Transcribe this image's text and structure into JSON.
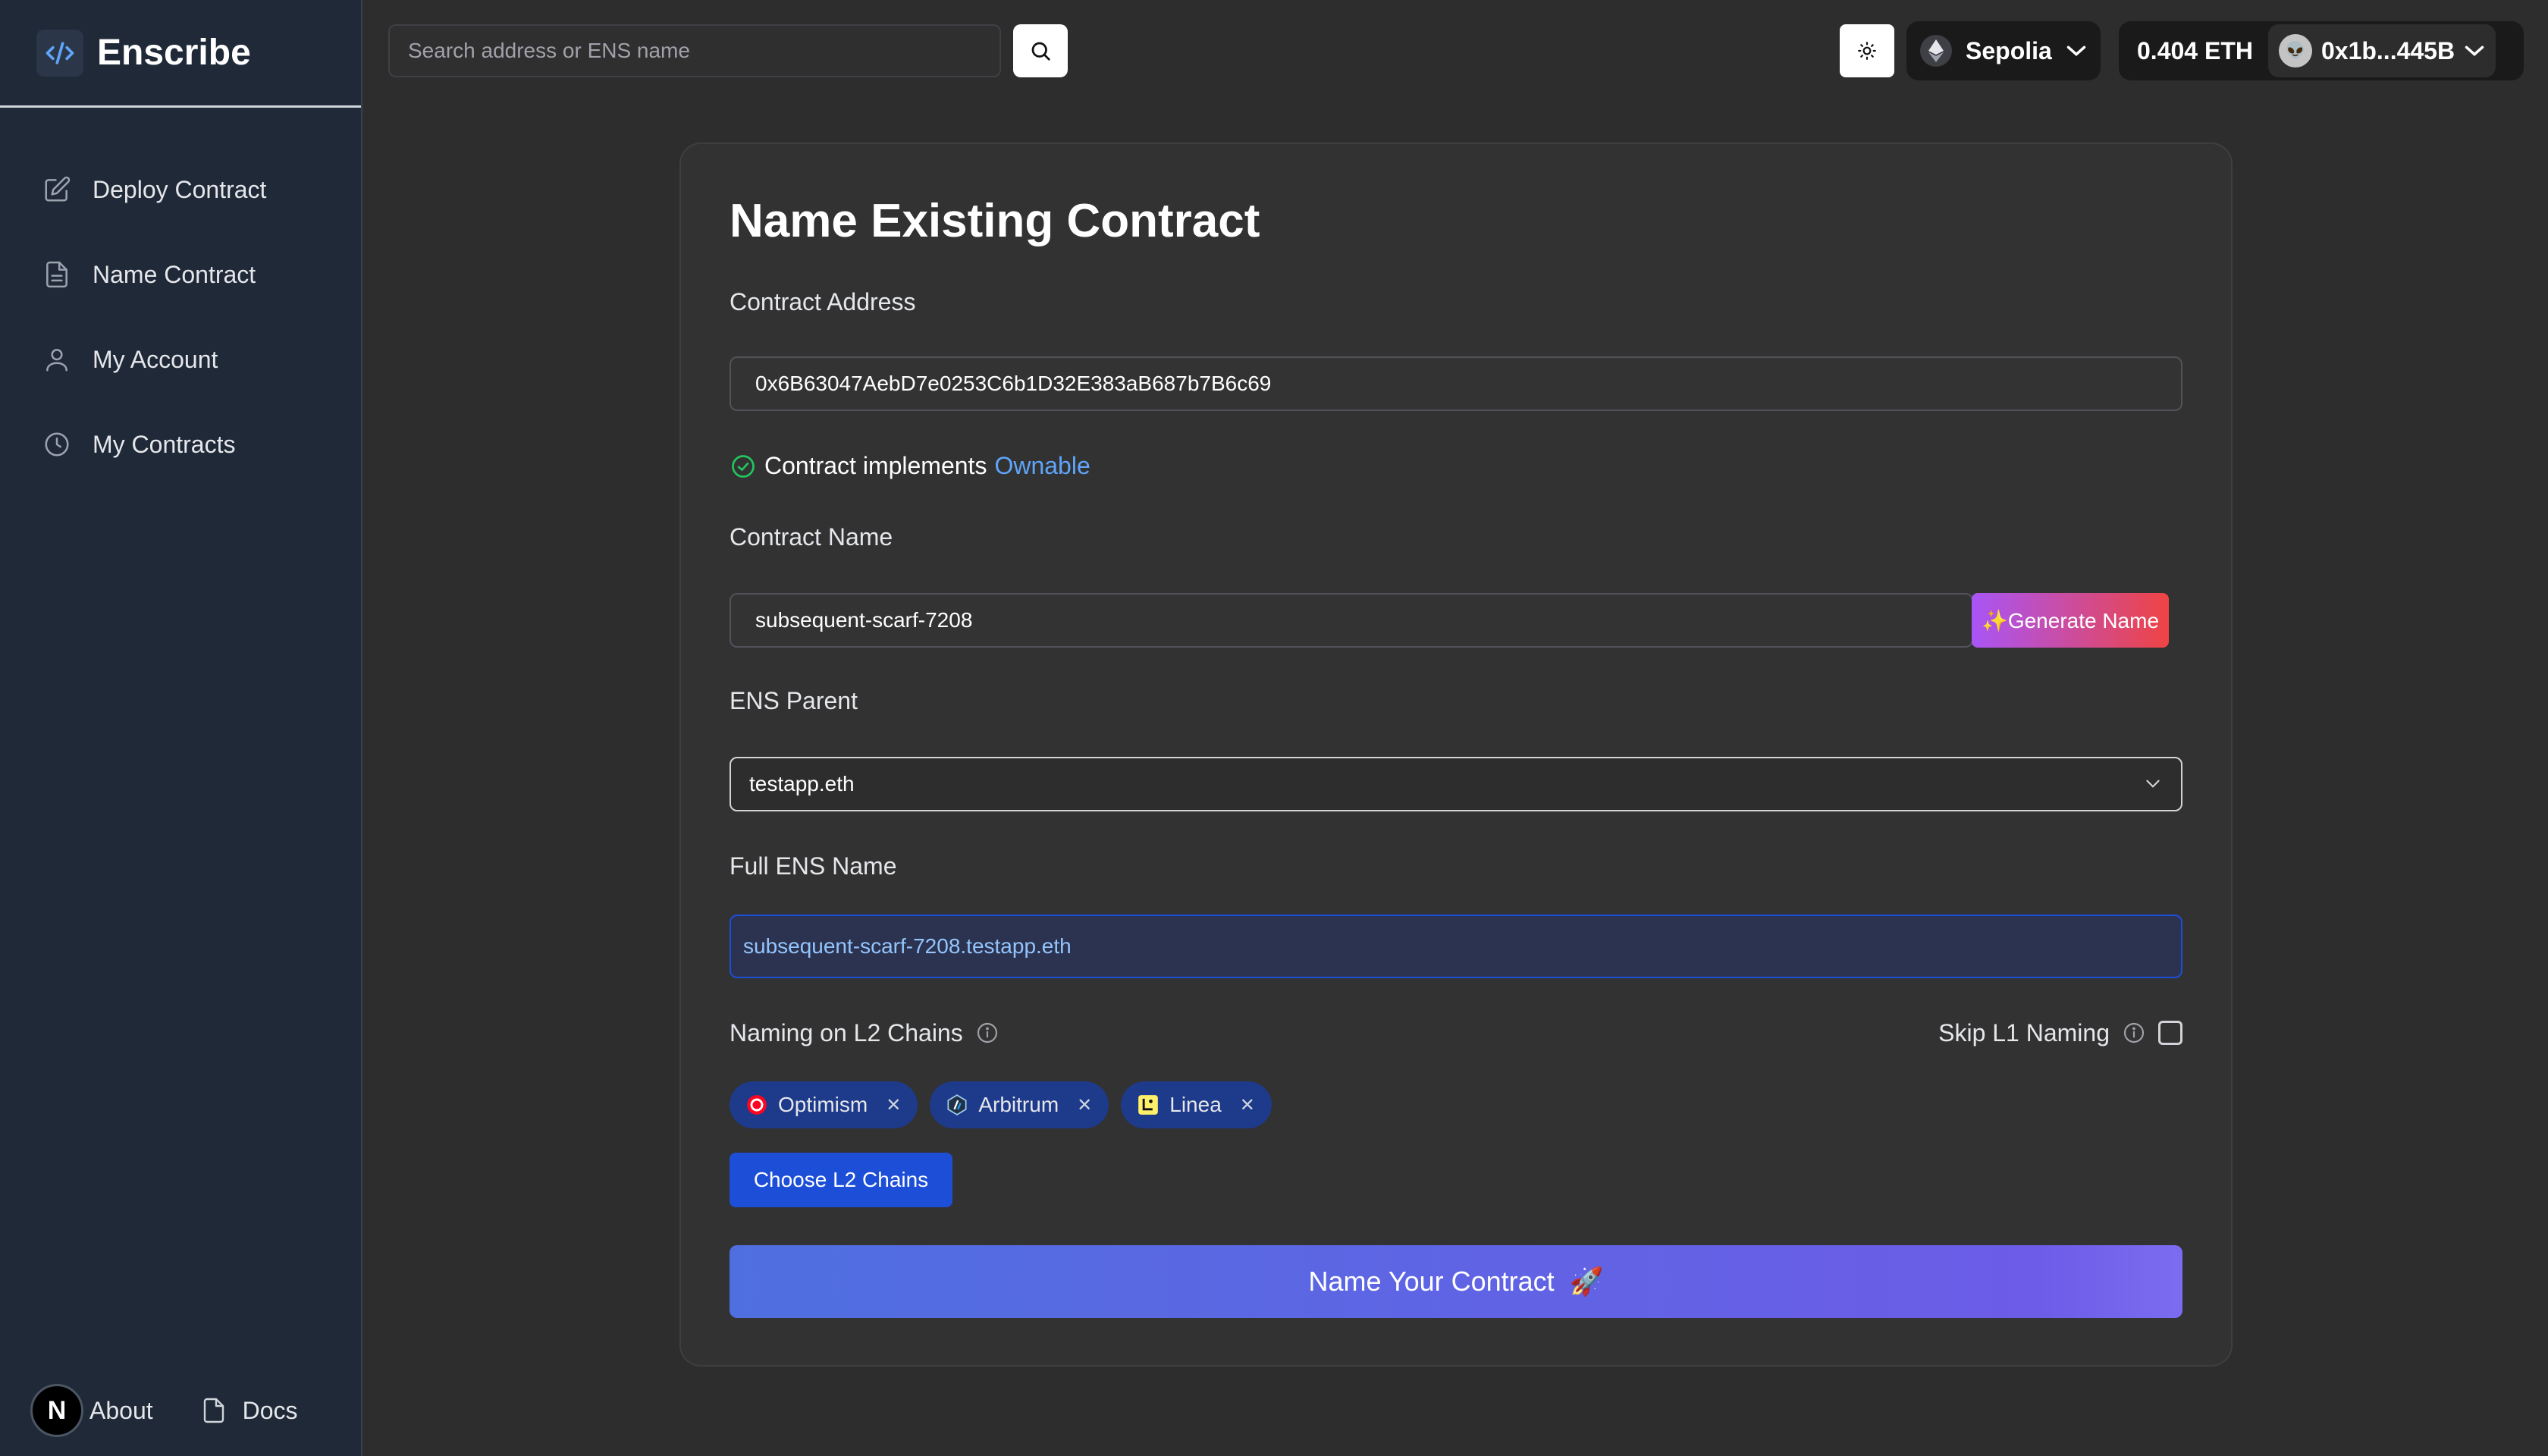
{
  "app": {
    "name": "Enscribe"
  },
  "sidebar": {
    "items": [
      {
        "label": "Deploy Contract",
        "icon": "edit-icon"
      },
      {
        "label": "Name Contract",
        "icon": "document-icon"
      },
      {
        "label": "My Account",
        "icon": "user-icon"
      },
      {
        "label": "My Contracts",
        "icon": "clock-icon"
      }
    ],
    "footer": {
      "badge": "N",
      "about": "About",
      "docs": "Docs"
    }
  },
  "header": {
    "search_placeholder": "Search address or ENS name",
    "network": "Sepolia",
    "balance": "0.404 ETH",
    "account": "0x1b...445B"
  },
  "form": {
    "title": "Name Existing Contract",
    "contract_address_label": "Contract Address",
    "contract_address": "0x6B63047AebD7e0253C6b1D32E383aB687b7B6c69",
    "implements_text": "Contract implements",
    "implements_link": "Ownable",
    "contract_name_label": "Contract Name",
    "contract_name": "subsequent-scarf-7208",
    "generate_label": "✨Generate Name",
    "ens_parent_label": "ENS Parent",
    "ens_parent": "testapp.eth",
    "full_ens_label": "Full ENS Name",
    "full_ens": "subsequent-scarf-7208.testapp.eth",
    "l2_label": "Naming on L2 Chains",
    "skip_l1_label": "Skip L1 Naming",
    "chains": [
      "Optimism",
      "Arbitrum",
      "Linea"
    ],
    "choose_label": "Choose L2 Chains",
    "submit_label": "Name Your Contract",
    "submit_emoji": "🚀"
  },
  "colors": {
    "accent": "#1d4ed8",
    "link": "#60a5fa",
    "sidebar": "#1f2937"
  }
}
